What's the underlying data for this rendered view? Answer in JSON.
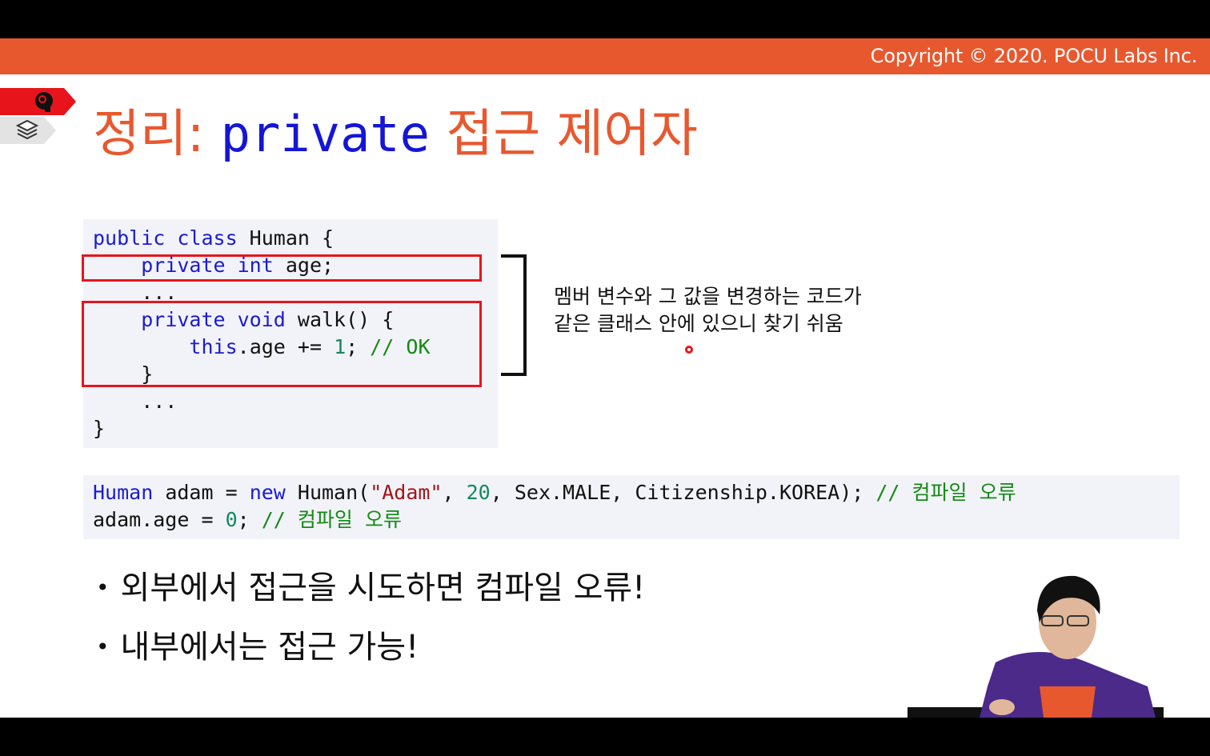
{
  "header": {
    "copyright": "Copyright © 2020. POCU Labs Inc."
  },
  "side_tabs": {
    "red_icon": "brain-gear-icon",
    "gray_icon": "stack-layers-icon"
  },
  "title": {
    "prefix": "정리: ",
    "keyword": "private",
    "suffix": " 접근 제어자"
  },
  "code_block_1": {
    "lines": [
      {
        "a": "public class",
        "b": " Human {"
      },
      {
        "indent": "    ",
        "a": "private int",
        "b": " age;"
      },
      {
        "text": "    ..."
      },
      {
        "indent": "    ",
        "a": "private void",
        "b": " walk() {"
      },
      {
        "indent": "        ",
        "a": "this",
        "b": ".age += ",
        "num": "1",
        "c": "; ",
        "comment": "// OK"
      },
      {
        "text": "    }"
      },
      {
        "text": "    ..."
      },
      {
        "text": "}"
      }
    ]
  },
  "note": {
    "line1": "멤버 변수와 그 값을 변경하는 코드가",
    "line2": "같은 클래스 안에 있으니 찾기 쉬움"
  },
  "code_block_2": {
    "line1": {
      "type": "Human",
      "var": " adam = ",
      "new": "new",
      "ctor": " Human(",
      "str": "\"Adam\"",
      "sep1": ", ",
      "num": "20",
      "rest": ", Sex.MALE, Citizenship.KOREA); ",
      "comment": "// 컴파일 오류"
    },
    "line2": {
      "a": "adam.age = ",
      "num": "0",
      "b": "; ",
      "comment": "// 컴파일 오류"
    }
  },
  "bullets": [
    "외부에서 접근을 시도하면 컴파일 오류!",
    "내부에서는 접근 가능!"
  ],
  "colors": {
    "accent": "#e8582f",
    "keyword": "#1a1ad6",
    "comment": "#138a13",
    "highlight": "#e8141c"
  }
}
